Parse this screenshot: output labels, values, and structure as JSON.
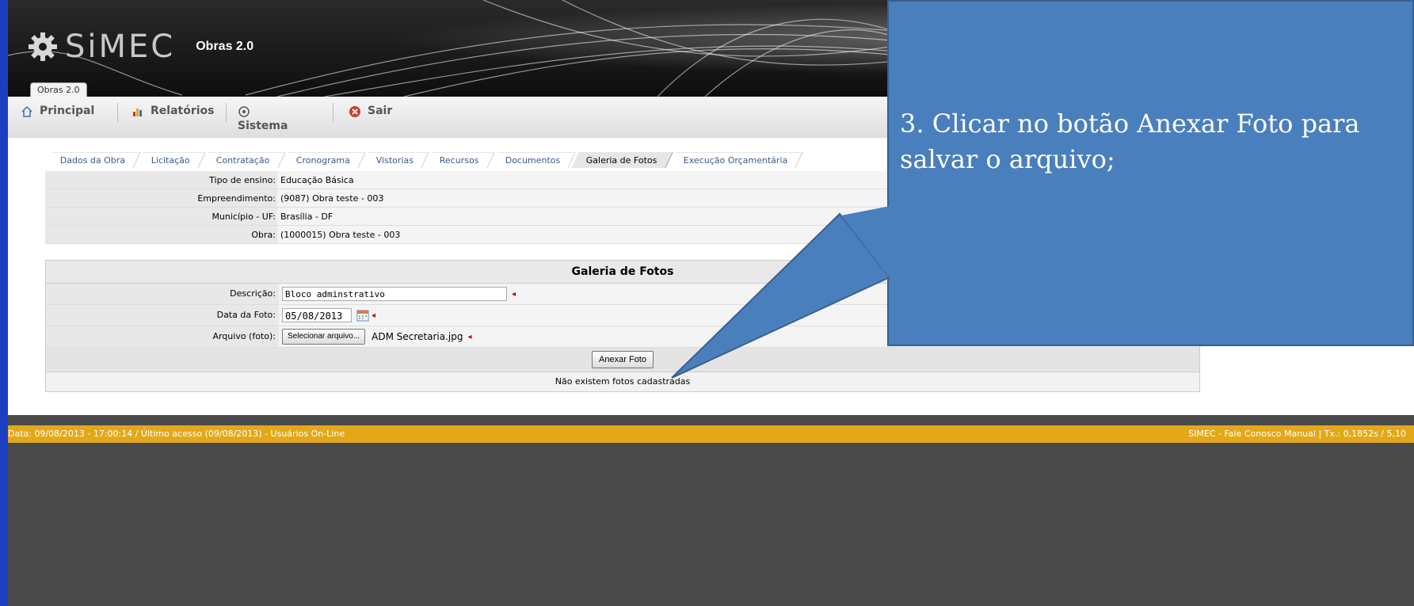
{
  "app": {
    "brand": "SiMEC",
    "module": "Obras 2.0",
    "system_tab": "Obras 2.0"
  },
  "menu": {
    "principal": "Principal",
    "relatorios": "Relatórios",
    "sistema": "Sistema",
    "sair": "Sair"
  },
  "tabs": [
    "Dados da Obra",
    "Licitação",
    "Contratação",
    "Cronograma",
    "Vistorias",
    "Recursos",
    "Documentos",
    "Galeria de Fotos",
    "Execução Orçamentária"
  ],
  "active_tab": "Galeria de Fotos",
  "info": {
    "tipo_label": "Tipo de ensino:",
    "tipo_value": "Educação Básica",
    "emp_label": "Empreendimento:",
    "emp_value": "(9087) Obra teste - 003",
    "mun_label": "Município - UF:",
    "mun_value": "Brasília - DF",
    "obra_label": "Obra:",
    "obra_value": "(1000015) Obra teste - 003"
  },
  "gallery": {
    "title": "Galeria de Fotos",
    "descricao_label": "Descrição:",
    "descricao_value": "Bloco adminstrativo",
    "data_label": "Data da Foto:",
    "data_value": "05/08/2013",
    "arquivo_label": "Arquivo (foto):",
    "select_file_button": "Selecionar arquivo...",
    "file_name": "ADM Secretaria.jpg",
    "attach_button": "Anexar Foto",
    "empty_message": "Não existem fotos cadastradas"
  },
  "footer": {
    "left": "Data: 09/08/2013 - 17:00:14 / Último acesso (09/08/2013) - Usuários On-Line",
    "right": "SIMEC - Fale Conosco Manual   | Tx.: 0,1852s / 5,10"
  },
  "callout": {
    "text": "3. Clicar no botão Anexar Foto para salvar o arquivo;"
  },
  "colors": {
    "callout": "#4a7fbd",
    "footer": "#e3a81a",
    "frame": "#1a3fc2"
  }
}
